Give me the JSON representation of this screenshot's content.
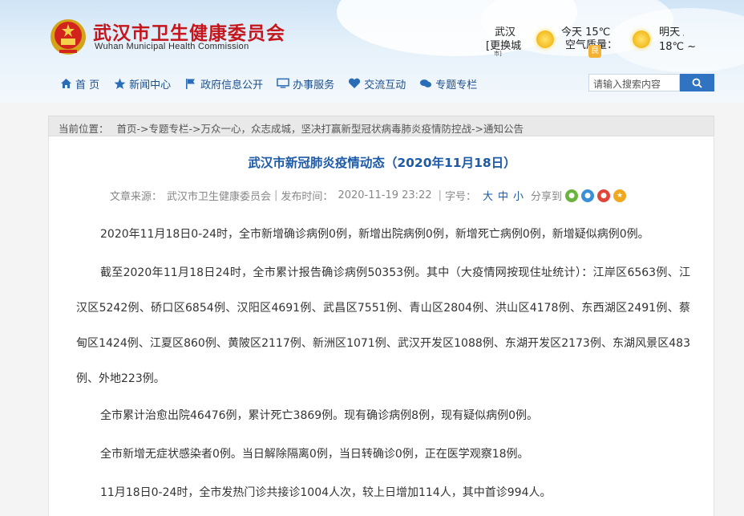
{
  "site": {
    "title": "武汉市卫生健康委员会",
    "subtitle": "Wuhan Municipal Health Commission"
  },
  "weather": {
    "city": "武汉",
    "switch_city": "[更换城",
    "switch_city_2": "市]",
    "today": "今天 15℃",
    "air_quality": "空气质量：",
    "tomorrow_label": "明天",
    "tomorrow_dots": "· ·",
    "tomorrow_temp": "18℃ ~",
    "aq_icon": "air-quality-icon"
  },
  "nav": {
    "items": [
      {
        "label": "首 页",
        "icon": "home-icon"
      },
      {
        "label": "新闻中心",
        "icon": "star-icon"
      },
      {
        "label": "政府信息公开",
        "icon": "flag-icon"
      },
      {
        "label": "办事服务",
        "icon": "monitor-icon"
      },
      {
        "label": "交流互动",
        "icon": "heart-icon"
      },
      {
        "label": "专题专栏",
        "icon": "chat-icon"
      }
    ],
    "search_placeholder": "请输入搜索内容"
  },
  "breadcrumb": {
    "label": "当前位置：",
    "path": "首页->专题专栏->万众一心，众志成城，坚决打赢新型冠状病毒肺炎疫情防控战->通知公告"
  },
  "article": {
    "title": "武汉市新冠肺炎疫情动态（2020年11月18日）",
    "source_label": "文章来源：",
    "source": "武汉市卫生健康委员会",
    "time_label": "发布时间：",
    "time": "2020-11-19 23:22",
    "fontsize_label": "字号：",
    "size_large": "大",
    "size_medium": "中",
    "size_small": "小",
    "share_label": "分享到",
    "paragraphs": [
      "2020年11月18日0-24时，全市新增确诊病例0例，新增出院病例0例，新增死亡病例0例，新增疑似病例0例。",
      "截至2020年11月18日24时，全市累计报告确诊病例50353例。其中（大疫情网按现住址统计）：江岸区6563例、江汉区5242例、硚口区6854例、汉阳区4691例、武昌区7551例、青山区2804例、洪山区4178例、东西湖区2491例、蔡甸区1424例、江夏区860例、黄陂区2117例、新洲区1071例、武汉开发区1088例、东湖开发区2173例、东湖风景区483例、外地223例。",
      "全市累计治愈出院46476例，累计死亡3869例。现有确诊病例8例，现有疑似病例0例。",
      "全市新增无症状感染者0例。当日解除隔离0例，当日转确诊0例，正在医学观察18例。",
      "11月18日0-24时，全市发热门诊共接诊1004人次，较上日增加114人，其中首诊994人。"
    ]
  },
  "colors": {
    "brand_red": "#c4161c",
    "nav_blue": "#1c4f8c",
    "title_blue": "#1d5aa8",
    "search_button": "#2f73c2"
  }
}
